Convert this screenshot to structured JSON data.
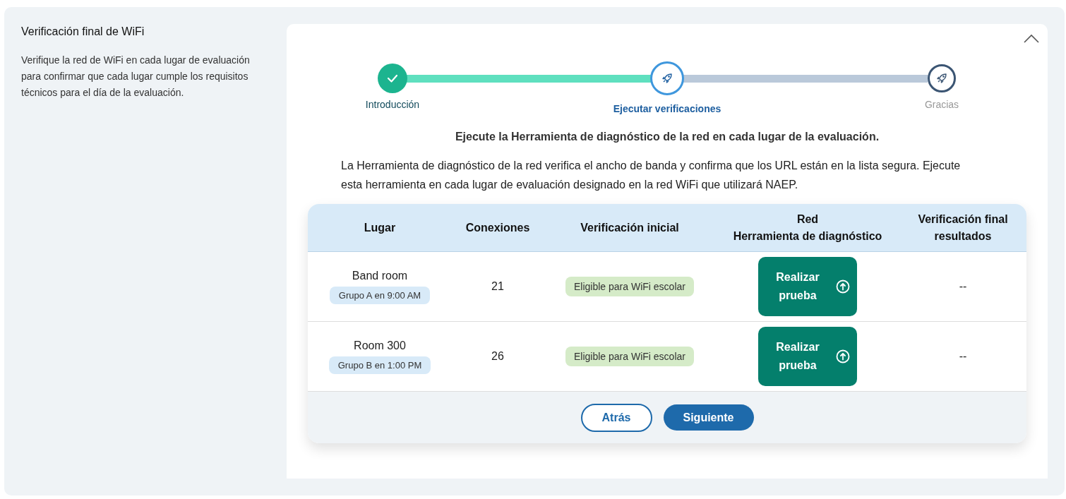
{
  "section": {
    "title": "Verificación final de WiFi",
    "description": "Verifique la red de WiFi en cada lugar de evaluación para confirmar que cada lugar cumple los requisitos técnicos para el día de la evaluación."
  },
  "card": {
    "collapsed": false,
    "steps": [
      {
        "label": "Introducción",
        "completed": true,
        "selected": false
      },
      {
        "label": "Ejecutar verificaciones",
        "completed": false,
        "selected": true
      },
      {
        "label": "Gracias",
        "completed": false,
        "selected": false
      }
    ],
    "heading": "Ejecute la Herramienta de diagnóstico de la red en cada lugar de la evaluación.",
    "intro": "La Herramienta de diagnóstico de la red verifica el ancho de banda y confirma que los URL están en la lista segura. Ejecute esta herramienta en cada lugar de evaluación designado en la red WiFi que utilizará NAEP.",
    "table": {
      "columns": [
        "Lugar",
        "Conexiones",
        "Verificación inicial",
        "Red\nHerramienta de diagnóstico",
        "Verificación final\nresultados"
      ],
      "rows": [
        {
          "place": "Band room",
          "group": "Grupo A en 9:00 AM",
          "connections": "21",
          "initial_check": "Eligible para WiFi escolar",
          "action": "Realizar prueba",
          "final_result": "--"
        },
        {
          "place": "Room 300",
          "group": "Grupo B en 1:00 PM",
          "connections": "26",
          "initial_check": "Eligible para WiFi escolar",
          "action": "Realizar prueba",
          "final_result": "--"
        }
      ]
    },
    "buttons": [
      {
        "label": "Atrás",
        "kind": "secondary"
      },
      {
        "label": "Siguiente",
        "kind": "primary"
      }
    ]
  }
}
